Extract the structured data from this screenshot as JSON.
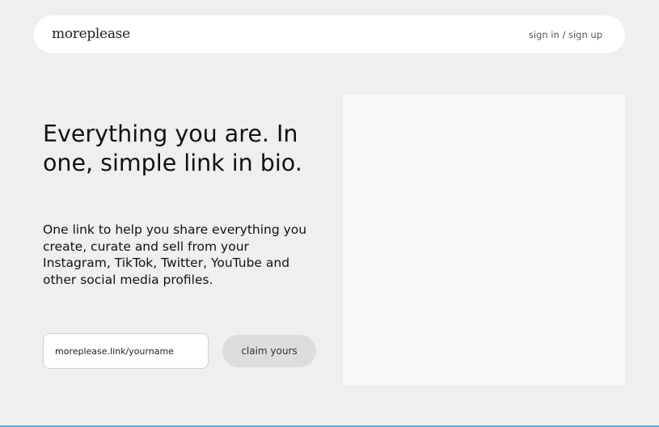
{
  "header": {
    "logo": "moreplease",
    "auth_link": "sign in / sign up"
  },
  "hero": {
    "headline": "Everything you are. In one, simple link in bio.",
    "subheadline": "One link to help you share everything you create, curate and sell from your Instagram, TikTok, Twitter, YouTube and other social media profiles."
  },
  "signup": {
    "url_value": "moreplease.link/yourname",
    "claim_label": "claim yours"
  },
  "colors": {
    "background": "#efefef",
    "navbar": "#ffffff",
    "button": "#dddddd",
    "preview_panel": "#f8f8f8",
    "bottom_accent": "#58b0e8"
  }
}
